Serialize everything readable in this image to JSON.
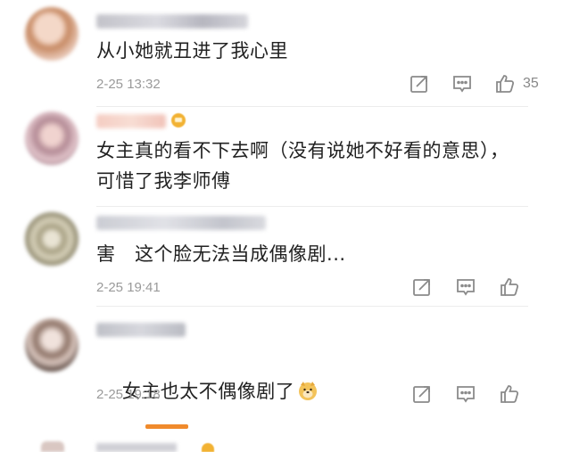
{
  "comments": [
    {
      "text": "从小她就丑进了我心里",
      "date": "2-25 13:32",
      "like_count": "35"
    },
    {
      "text": "女主真的看不下去啊（没有说她不好看的意思），\n可惜了我李师傅",
      "date": "",
      "like_count": ""
    },
    {
      "text": "害   这个脸无法当成偶像剧...",
      "date": "2-25 19:41",
      "like_count": ""
    },
    {
      "text": "女主也太不偶像剧了",
      "date": "2-25 19:18",
      "like_count": "",
      "emoji_icon": "doge-emoji-icon"
    }
  ],
  "colors": {
    "accent": "#f08a2c",
    "meta_text": "#9a9a9a",
    "icon": "#8a8a8a",
    "vip": "#f2b233"
  },
  "icons": [
    "share-icon",
    "comment-icon",
    "like-icon",
    "vip-crown-icon"
  ]
}
